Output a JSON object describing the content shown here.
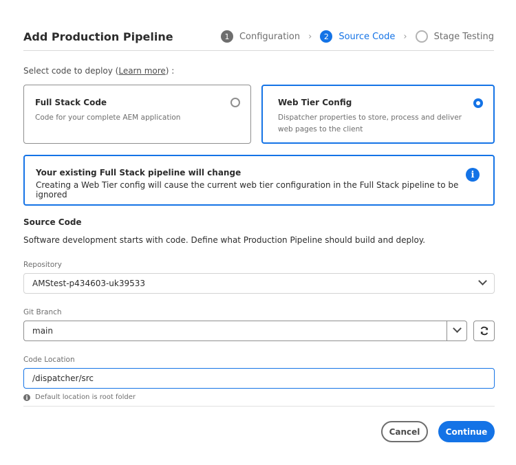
{
  "header": {
    "title": "Add Production Pipeline",
    "steps": [
      {
        "number": "1",
        "label": "Configuration",
        "state": "done"
      },
      {
        "number": "2",
        "label": "Source Code",
        "state": "active"
      },
      {
        "number": "",
        "label": "Stage Testing",
        "state": "todo"
      }
    ]
  },
  "select": {
    "prefix": "Select code to deploy (",
    "link": "Learn more",
    "suffix": ") :"
  },
  "options": [
    {
      "title": "Full Stack Code",
      "description": "Code for your complete AEM application",
      "selected": false
    },
    {
      "title": "Web Tier Config",
      "description": "Dispatcher properties to store, process and deliver web pages to the client",
      "selected": true
    }
  ],
  "alert": {
    "title": "Your existing Full Stack pipeline will change",
    "text": "Creating a Web Tier config will cause the current web tier configuration in the Full Stack pipeline to be ignored"
  },
  "source": {
    "title": "Source Code",
    "description": "Software development starts with code. Define what Production Pipeline should build and deploy."
  },
  "form": {
    "repository_label": "Repository",
    "repository_value": "AMStest-p434603-uk39533",
    "branch_label": "Git Branch",
    "branch_value": "main",
    "location_label": "Code Location",
    "location_value": "/dispatcher/src",
    "location_hint": "Default location is root folder"
  },
  "buttons": {
    "cancel": "Cancel",
    "continue": "Continue"
  },
  "colors": {
    "accent": "#1473e6",
    "text": "#2c2c2c",
    "muted": "#6e6e6e"
  }
}
